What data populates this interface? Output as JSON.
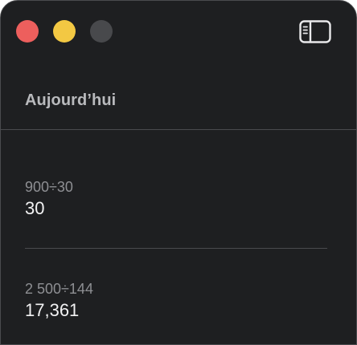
{
  "window": {
    "controls": {
      "close_color": "#ed5f5d",
      "minimize_color": "#f3c843",
      "zoom_color": "#48494c"
    },
    "toolbar": {
      "sidebar_toggle_icon": "sidebar-toggle-icon"
    }
  },
  "history": {
    "section_title": "Aujourd’hui",
    "items": [
      {
        "expression": "900÷30",
        "result": "30"
      },
      {
        "expression": "2 500÷144",
        "result": "17,361"
      }
    ]
  }
}
